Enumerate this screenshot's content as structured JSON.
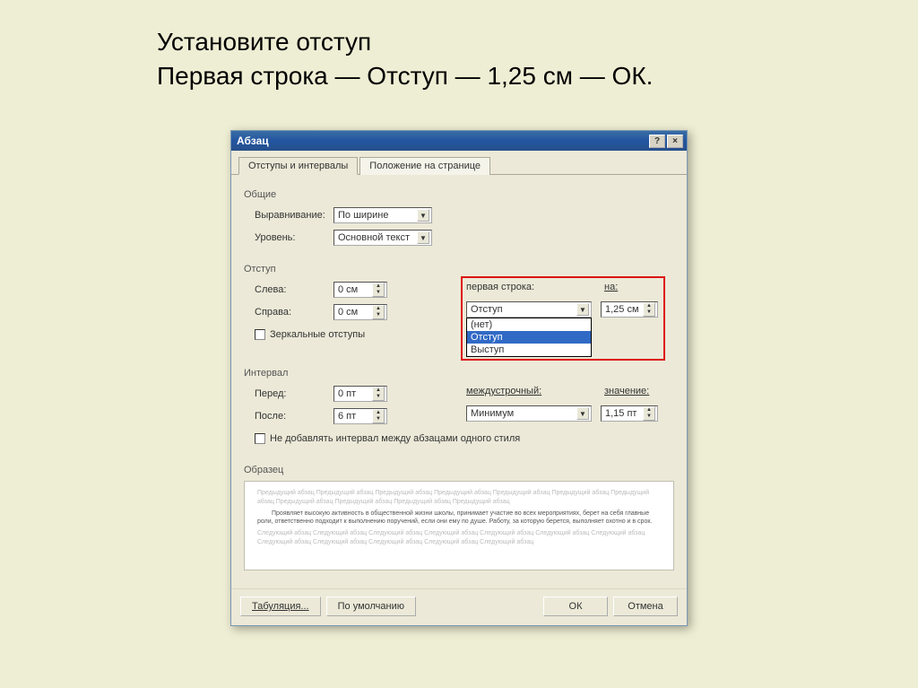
{
  "instruction": {
    "line1": "Установите отступ",
    "line2": "Первая строка — Отступ — 1,25 см — ОК."
  },
  "dialog": {
    "title": "Абзац",
    "help_icon": "?",
    "close_icon": "×",
    "tabs": {
      "tab1": "Отступы и интервалы",
      "tab2": "Положение на странице"
    },
    "general": {
      "label": "Общие",
      "align_label": "Выравнивание:",
      "align_value": "По ширине",
      "level_label": "Уровень:",
      "level_value": "Основной текст"
    },
    "indent": {
      "label": "Отступ",
      "left_label": "Слева:",
      "left_value": "0 см",
      "right_label": "Справа:",
      "right_value": "0 см",
      "mirror_label": "Зеркальные отступы",
      "firstline_label": "первая строка:",
      "on_label": "на:",
      "firstline_value": "Отступ",
      "on_value": "1,25 см",
      "options": {
        "o1": "(нет)",
        "o2": "Отступ",
        "o3": "Выступ"
      }
    },
    "spacing": {
      "label": "Интервал",
      "before_label": "Перед:",
      "before_value": "0 пт",
      "after_label": "После:",
      "after_value": "6 пт",
      "line_label": "междустрочный:",
      "value_label": "значение:",
      "line_value": "Минимум",
      "value_value": "1,15 пт",
      "noadd_label": "Не добавлять интервал между абзацами одного стиля"
    },
    "preview": {
      "label": "Образец",
      "gray1": "Предыдущий абзац Предыдущий абзац Предыдущий абзац Предыдущий абзац Предыдущий абзац Предыдущий абзац Предыдущий абзац Предыдущий абзац Предыдущий абзац Предыдущий абзац Предыдущий абзац",
      "dark": "Проявляет высокую активность в общественной жизни школы, принимает участие во всех мероприятиях, берет на себя главные роли, ответственно подходит к выполнению поручений, если они ему по душе. Работу, за которую берется, выполняет охотно и в срок.",
      "gray2": "Следующий абзац Следующий абзац Следующий абзац Следующий абзац Следующий абзац Следующий абзац Следующий абзац Следующий абзац Следующий абзац Следующий абзац Следующий абзац Следующий абзац"
    },
    "buttons": {
      "tabs": "Табуляция...",
      "default": "По умолчанию",
      "ok": "ОК",
      "cancel": "Отмена"
    }
  }
}
